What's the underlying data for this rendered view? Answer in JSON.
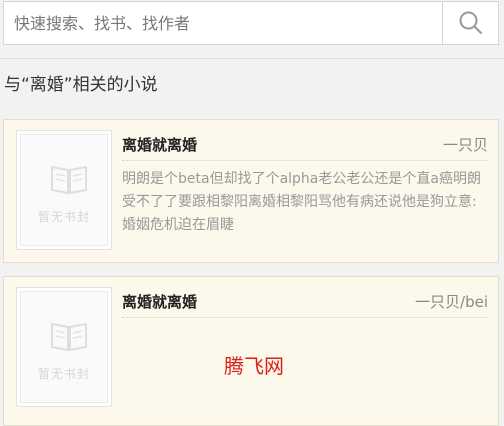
{
  "search": {
    "placeholder": "快速搜索、找书、找作者",
    "value": ""
  },
  "section": {
    "title": "与“离婚”相关的小说"
  },
  "books": [
    {
      "title": "离婚就离婚",
      "author": "一只贝",
      "description": "明朗是个beta但却找了个alpha老公老公还是个直a癌明朗受不了了要跟相黎阳离婚相黎阳骂他有病还说他是狗立意:婚姻危机迫在眉睫",
      "cover_text": "暂无书封"
    },
    {
      "title": "离婚就离婚",
      "author": "一只贝/bei",
      "description": "",
      "cover_text": "暂无书封"
    }
  ],
  "watermark": "腾飞网",
  "icons": {
    "search": "search-icon",
    "cover": "open-book-icon"
  },
  "colors": {
    "card_background": "#fdf8ec",
    "watermark": "#d9201a"
  }
}
